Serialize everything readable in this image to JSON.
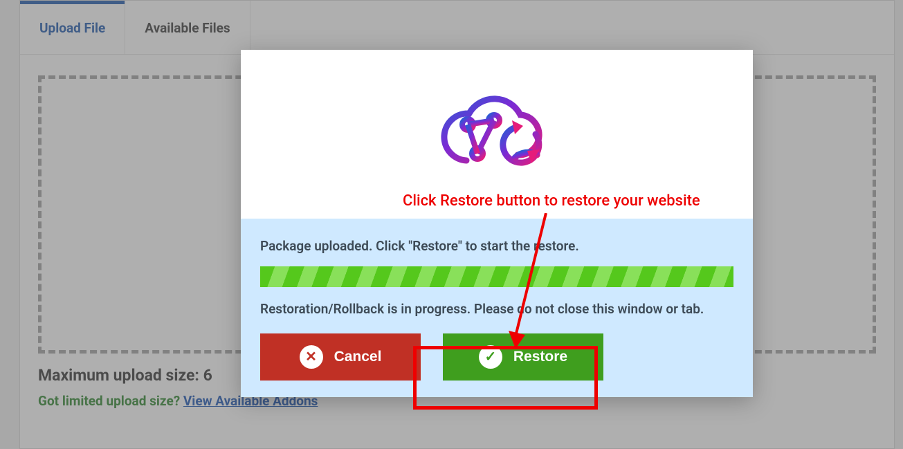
{
  "tabs": {
    "upload": "Upload File",
    "available": "Available Files"
  },
  "upload_size_line": "Maximum upload size: 6",
  "limited": {
    "text": "Got limited upload size? ",
    "link": "View Available Addons"
  },
  "modal": {
    "msg_uploaded": "Package uploaded. Click \"Restore\" to start the restore.",
    "msg_progress": "Restoration/Rollback is in progress. Please do not close this window or tab.",
    "cancel_label": "Cancel",
    "restore_label": "Restore"
  },
  "annotation": {
    "text": "Click Restore button to restore your website"
  }
}
